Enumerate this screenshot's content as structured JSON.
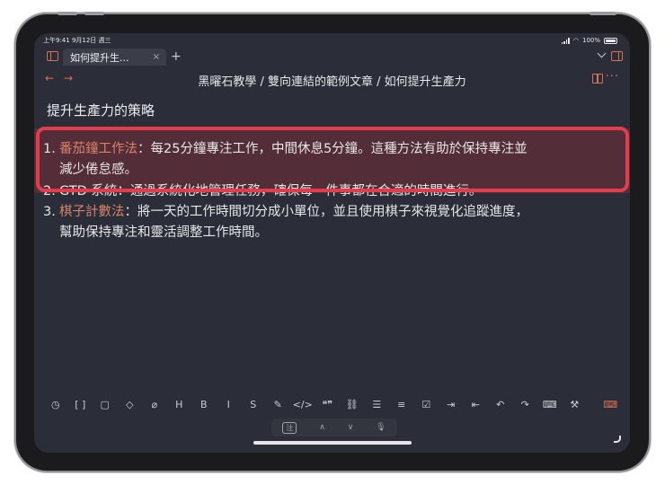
{
  "status": {
    "time_date": "上午9:41  9月12日 週三",
    "battery": "100%"
  },
  "tabbar": {
    "active_tab": "如何提升生...",
    "close": "×",
    "new_tab": "+"
  },
  "navbar": {
    "back": "←",
    "forward": "→",
    "breadcrumb": "黑曜石教學 / 雙向連結的範例文章 / 如何提升生產力",
    "more": "···"
  },
  "document": {
    "title": "提升生產力的策略",
    "items": [
      {
        "num": "1.",
        "keyword": "番茄鐘工作法",
        "line1": "：每25分鐘專注工作，中間休息5分鐘。這種方法有助於保持專注並",
        "line2": "減少倦怠感。"
      },
      {
        "num": "2.",
        "text": "GTD 系統：通過系統化地管理任務，確保每一件事都在合適的時間進行。"
      },
      {
        "num": "3.",
        "keyword": "棋子計數法",
        "line1": "：將一天的工作時間切分成小單位，並且使用棋子來視覺化追蹤進度，",
        "line2": "幫助保持專注和靈活調整工作時間。"
      }
    ]
  },
  "toolbar": {
    "icons": [
      "clock-icon",
      "brackets-icon",
      "file-icon",
      "tag-icon",
      "paperclip-icon",
      "heading-icon",
      "bold-icon",
      "italic-icon",
      "strikethrough-icon",
      "highlight-icon",
      "code-icon",
      "quote-icon",
      "link-icon",
      "bullet-list-icon",
      "numbered-list-icon",
      "checkbox-icon",
      "indent-icon",
      "outdent-icon",
      "undo-icon",
      "redo-icon",
      "command-palette-icon",
      "wrench-icon",
      "keyboard-hide-icon"
    ],
    "glyphs": [
      "◷",
      "[ ]",
      "▢",
      "◇",
      "⌀",
      "H",
      "B",
      "I",
      "S",
      "✎",
      "</>",
      "❝❞",
      "⛓",
      "☰",
      "≡",
      "☑",
      "⇥",
      "⇤",
      "↶",
      "↷",
      "⌨",
      "⚒",
      "⌨"
    ]
  },
  "keyboard_bar": {
    "lang": "注",
    "up": "∧",
    "down": "∨",
    "mic": "🎙"
  },
  "colors": {
    "accent": "#d96f56",
    "keyword": "#d9826b",
    "background": "#2b2e38",
    "annotation_box": "#e23c4e"
  }
}
